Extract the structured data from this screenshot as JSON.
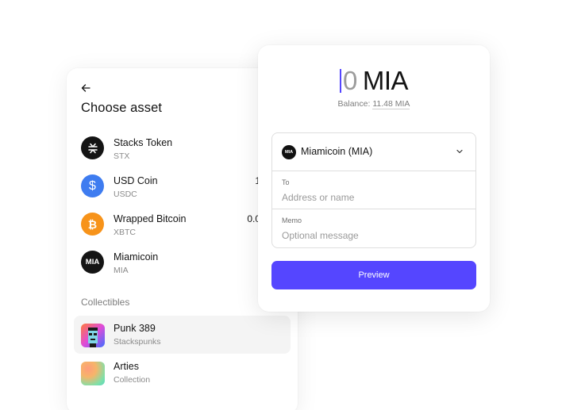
{
  "choose_asset": {
    "title": "Choose asset",
    "tokens": [
      {
        "name": "Stacks Token",
        "symbol": "STX",
        "amount": "",
        "icon": "stacks-icon",
        "icon_glyph": "✱",
        "color": "#141414"
      },
      {
        "name": "USD Coin",
        "symbol": "USDC",
        "amount": "1",
        "icon": "dollar-icon",
        "icon_glyph": "$",
        "color": "#3e7cf0"
      },
      {
        "name": "Wrapped Bitcoin",
        "symbol": "XBTC",
        "amount": "0.0",
        "icon": "bitcoin-icon",
        "icon_glyph": "₿",
        "color": "#f7931a"
      },
      {
        "name": "Miamicoin",
        "symbol": "MIA",
        "amount": "",
        "icon": "miamicoin-icon",
        "icon_glyph": "MIA",
        "color": "#141414"
      }
    ],
    "collectibles_label": "Collectibles",
    "collectibles": [
      {
        "name": "Punk 389",
        "sub": "Stackspunks",
        "icon": "punk-thumbnail"
      },
      {
        "name": "Arties",
        "sub": "Collection",
        "icon": "arties-thumbnail"
      }
    ]
  },
  "send": {
    "amount": "0",
    "unit": "MIA",
    "balance_label": "Balance:",
    "balance_value": "11.48 MIA",
    "asset_select": {
      "label": "Miamicoin (MIA)",
      "icon_text": "MIA"
    },
    "to": {
      "label": "To",
      "placeholder": "Address or name"
    },
    "memo": {
      "label": "Memo",
      "placeholder": "Optional message"
    },
    "preview_label": "Preview"
  },
  "colors": {
    "accent": "#5546ff",
    "usdc": "#3e7cf0",
    "btc": "#f7931a"
  }
}
